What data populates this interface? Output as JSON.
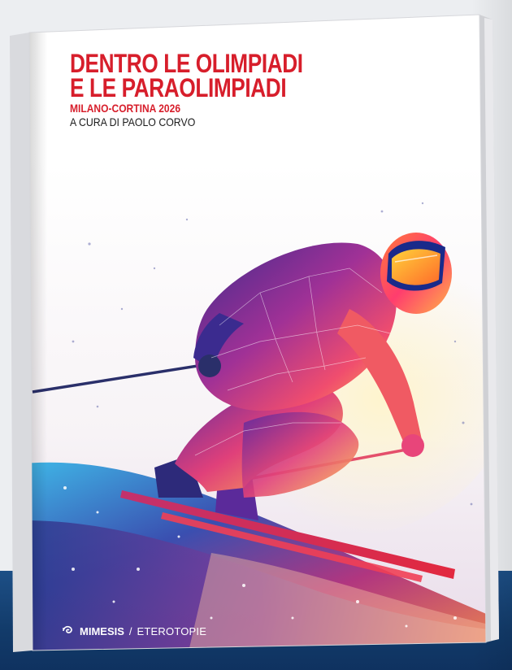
{
  "cover": {
    "title_line1": "DENTRO LE OLIMPIADI",
    "title_line2": "E LE PARAOLIMPIADI",
    "subtitle": "MILANO-CORTINA 2026",
    "author": "A CURA DI PAOLO CORVO"
  },
  "publisher": {
    "logo_icon": "spiral-logo-icon",
    "brand": "MIMESIS",
    "separator": "/",
    "series": "ETEROTOPIE"
  },
  "colors": {
    "title_red": "#d71e2b",
    "author_text": "#1b1b1b",
    "background_band": "#123b6a",
    "page_background": "#eceef1"
  }
}
